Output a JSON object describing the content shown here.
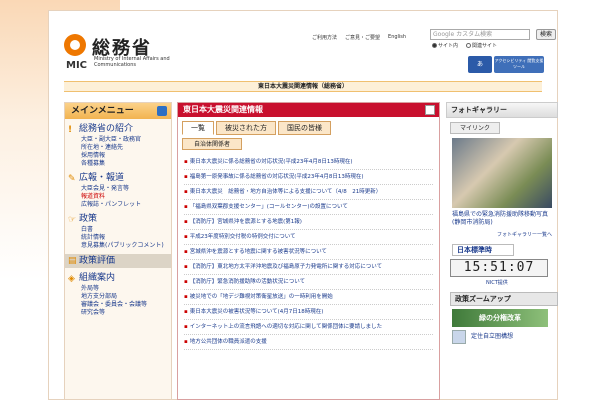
{
  "header": {
    "logo_name": "総務省",
    "logo_mic": "MIC",
    "logo_en": "Ministry of Internal Affairs and Communications",
    "top_links": [
      "ご利用方法",
      "ご意見・ご要望",
      "English"
    ],
    "search_placeholder": "Google カスタム検索",
    "search_button": "検索",
    "radio_site": "サイト内",
    "radio_related": "関連サイト",
    "btn_text": "あ",
    "btn_accessibility": "アクセシビリティ 閲覧支援ツール"
  },
  "banner": "東日本大震災関連情報（総務省）",
  "left_menu": {
    "title": "メインメニュー",
    "sections": [
      {
        "title": "総務省の紹介",
        "subs": [
          "大臣・副大臣・政務官",
          "所在地・連絡先",
          "採用情報",
          "各種募集"
        ]
      },
      {
        "title": "広報・報道",
        "subs": [
          "大臣会見・発言等",
          "報道資料",
          "広報誌・パンフレット"
        ]
      },
      {
        "title": "政策",
        "subs": [
          "白書",
          "統計情報",
          "意見募集(パブリックコメント)"
        ]
      }
    ],
    "bar_section": "政策評価",
    "sections2": [
      {
        "title": "組織案内",
        "subs": [
          "外局等",
          "地方支分部局",
          "審議会・委員会・会議等",
          "研究会等"
        ]
      }
    ]
  },
  "center": {
    "title": "東日本大震災関連情報",
    "tabs": [
      "一覧",
      "被災された方",
      "国民の皆様"
    ],
    "subtab": "自治体関係者",
    "items": [
      "東日本大震災に係る総務省の対応状況(平成23年4月8日13時現在)",
      "福島第一原発事故に係る総務省の対応状況(平成23年4月8日13時現在)",
      "東日本大震災　総務省・地方自治体等による支援について（4/8　21時更新）",
      "「福島県双葉郡支援センター」(コールセンター)の設置について",
      "【消防庁】宮城県沖を震源とする地震(第1報)",
      "平成23年度特別交付税の特例交付について",
      "宮城県沖を震源とする地震に関する被害状況等について",
      "【消防庁】東北地方太平洋沖地震及び福島原子力発電所に関する対応について",
      "【消防庁】緊急消防援助隊の活動状況について",
      "被災地での「地デジ難視対策衛星放送」の一時利用を開始",
      "東日本大震災の被害状況等について(4月7日18時現在)",
      "インターネット上の流言飛語への適切な対応に関して関係団体に要請しました",
      "地方公共団体の職員派遣の支援"
    ]
  },
  "right": {
    "gallery_title": "フォトギャラリー",
    "gallery_tab": "マイリンク",
    "photo_caption": "福島県での緊急消防援助隊移動写真(静岡市消防局)",
    "more_link": "フォトギャラリー一覧へ",
    "clock_title": "日本標準時",
    "clock_time": "15:51:07",
    "clock_note": "NICT提供",
    "zoom_title": "政策ズームアップ",
    "zoom_banner": "緑の分権改革",
    "zoom_caption": "定住自立圏構想"
  }
}
